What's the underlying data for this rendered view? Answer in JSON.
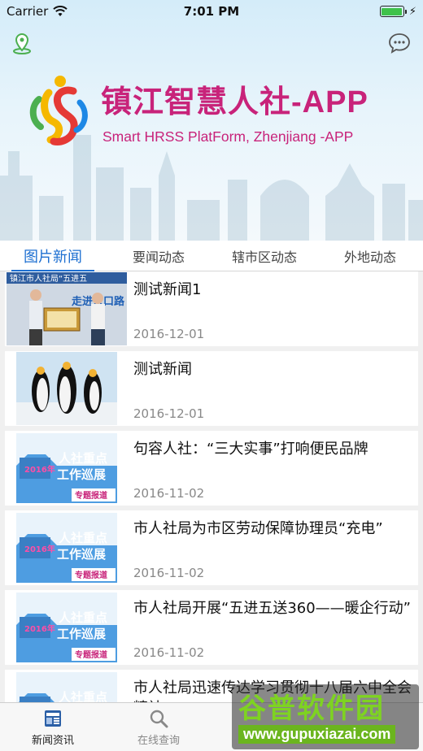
{
  "status_bar": {
    "carrier": "Carrier",
    "time": "7:01 PM"
  },
  "header": {
    "app_title": "镇江智慧人社-APP",
    "app_subtitle": "Smart HRSS PlatForm, Zhenjiang -APP",
    "left_icon": "map-pin-icon",
    "right_icon": "chat-bubble-icon"
  },
  "tabs": [
    {
      "label": "图片新闻",
      "active": true
    },
    {
      "label": "要闻动态",
      "active": false
    },
    {
      "label": "辖市区动态",
      "active": false
    },
    {
      "label": "外地动态",
      "active": false
    }
  ],
  "news": [
    {
      "title": "测试新闻1",
      "date": "2016-12-01",
      "thumb": "award-photo"
    },
    {
      "title": "测试新闻",
      "date": "2016-12-01",
      "thumb": "penguins-photo"
    },
    {
      "title": "句容人社：“三大实事”打响便民品牌",
      "date": "2016-11-02",
      "thumb": "tour-poster"
    },
    {
      "title": "市人社局为市区劳动保障协理员“充电”",
      "date": "2016-11-02",
      "thumb": "tour-poster"
    },
    {
      "title": "市人社局开展“五进五送360——暖企行动”",
      "date": "2016-11-02",
      "thumb": "tour-poster"
    },
    {
      "title": "市人社局迅速传达学习贯彻十八届六中全会精神",
      "date": "",
      "thumb": "tour-poster"
    }
  ],
  "thumb_text": {
    "award_banner": "镇江市人社局“五进五",
    "award_sub": "走进京口路",
    "poster_year": "2016年",
    "poster_line1": "人社重点",
    "poster_line2": "工作巡展",
    "poster_tag": "专题报道"
  },
  "tabbar": [
    {
      "label": "新闻资讯",
      "icon": "news-icon",
      "active": true
    },
    {
      "label": "在线查询",
      "icon": "search-icon",
      "active": false
    }
  ],
  "watermark": {
    "line1": "谷普软件园",
    "line2": "www.gupuxiazai.com"
  },
  "colors": {
    "accent": "#1d6fd1",
    "brand": "#c8237a",
    "battery": "#3fc24b"
  }
}
